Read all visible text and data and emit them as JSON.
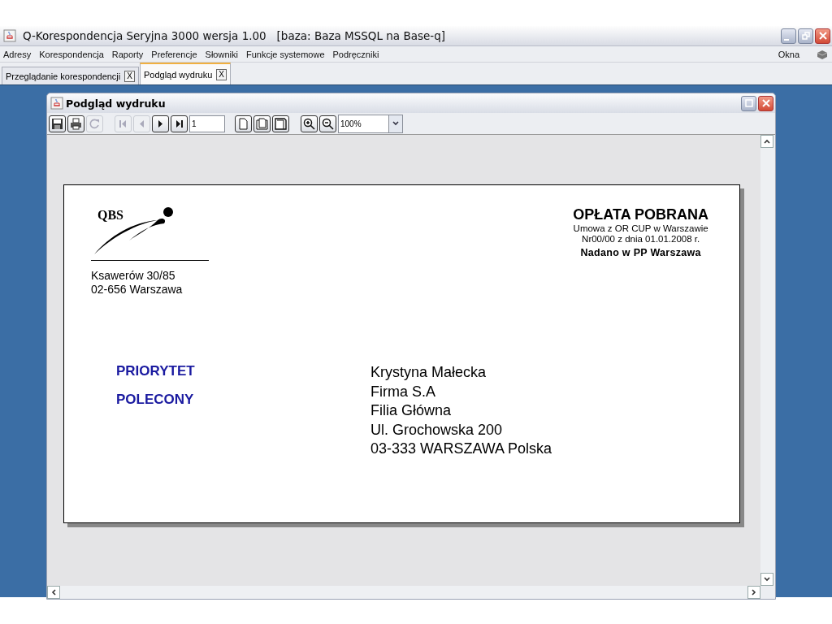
{
  "window": {
    "title": "Q-Korespondencja Seryjna 3000 wersja 1.00   [baza: Baza MSSQL na Base-q]"
  },
  "menu": {
    "items": [
      "Adresy",
      "Korespondencja",
      "Raporty",
      "Preferencje",
      "Słowniki",
      "Funkcje systemowe",
      "Podręczniki"
    ],
    "right": "Okna"
  },
  "tabs": [
    {
      "label": "Przeglądanie korespondencji",
      "close": "X",
      "selected": false
    },
    {
      "label": "Podgląd wydruku",
      "close": "X",
      "selected": true
    }
  ],
  "preview": {
    "title": "Podgląd wydruku",
    "toolbar": [
      [
        {
          "kind": "save",
          "disabled": false
        },
        {
          "kind": "print",
          "disabled": false
        },
        {
          "kind": "refresh",
          "disabled": true
        }
      ],
      [
        {
          "kind": "first",
          "disabled": true
        },
        {
          "kind": "prev",
          "disabled": true
        },
        {
          "kind": "next",
          "disabled": false
        },
        {
          "kind": "last",
          "disabled": false
        },
        {
          "kind": "field",
          "value": "1"
        }
      ],
      [
        {
          "kind": "page",
          "disabled": false
        },
        {
          "kind": "width",
          "disabled": false
        },
        {
          "kind": "fit",
          "disabled": false
        }
      ],
      [
        {
          "kind": "zoomin",
          "disabled": false
        },
        {
          "kind": "zoomout",
          "disabled": false
        },
        {
          "kind": "combo",
          "value": "100%"
        }
      ]
    ],
    "document": {
      "logo": "QBS",
      "sender": [
        "Ksawerów 30/85",
        "02-656 Warszawa"
      ],
      "fee": {
        "heading": "OPŁATA POBRANA",
        "lines": [
          "Umowa z OR CUP w Warszawie",
          "Nr00/00 z dnia 01.01.2008 r."
        ],
        "note": "Nadano w PP Warszawa"
      },
      "labels": [
        "PRIORYTET",
        "POLECONY"
      ],
      "recipient": [
        "Krystyna Małecka",
        "Firma S.A",
        "Filia Główna",
        "Ul. Grochowska 200",
        "03-333 WARSZAWA Polska"
      ]
    }
  }
}
